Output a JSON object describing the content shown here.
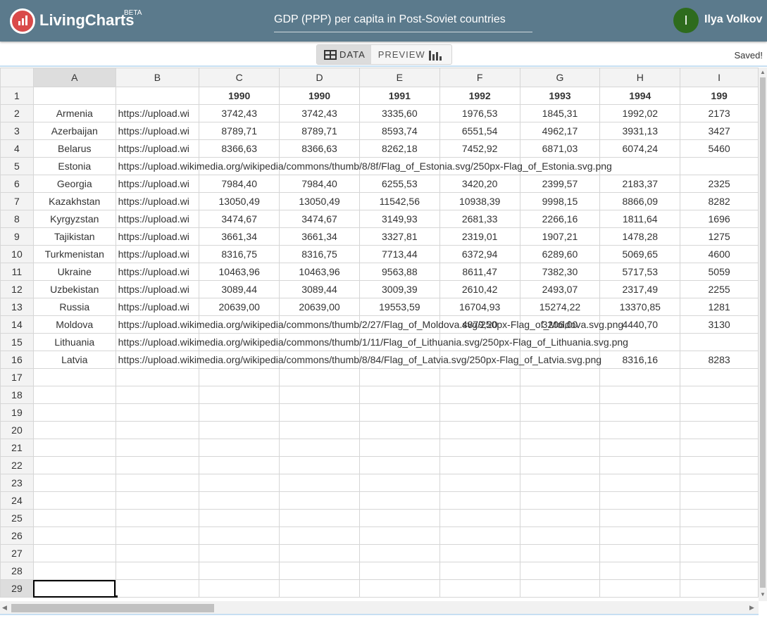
{
  "header": {
    "brand": "LivingCharts",
    "beta": "BETA",
    "chart_title": "GDP (PPP) per capita in Post-Soviet countries",
    "user_initial": "I",
    "user_name": "Ilya Volkov"
  },
  "toolbar": {
    "data_label": "DATA",
    "preview_label": "PREVIEW",
    "status": "Saved!"
  },
  "sheet": {
    "columns": [
      "A",
      "B",
      "C",
      "D",
      "E",
      "F",
      "G",
      "H",
      "I"
    ],
    "rows": [
      [
        "",
        "",
        "1990",
        "1990",
        "1991",
        "1992",
        "1993",
        "1994",
        "199"
      ],
      [
        "Armenia",
        "https://upload.wi",
        "3742,43",
        "3742,43",
        "3335,60",
        "1976,53",
        "1845,31",
        "1992,02",
        "2173"
      ],
      [
        "Azerbaijan",
        "https://upload.wi",
        "8789,71",
        "8789,71",
        "8593,74",
        "6551,54",
        "4962,17",
        "3931,13",
        "3427"
      ],
      [
        "Belarus",
        "https://upload.wi",
        "8366,63",
        "8366,63",
        "8262,18",
        "7452,92",
        "6871,03",
        "6074,24",
        "5460"
      ],
      [
        "Estonia",
        "https://upload.wikimedia.org/wikipedia/commons/thumb/8/8f/Flag_of_Estonia.svg/250px-Flag_of_Estonia.svg.png",
        "",
        "",
        "",
        "",
        "",
        "",
        ""
      ],
      [
        "Georgia",
        "https://upload.wi",
        "7984,40",
        "7984,40",
        "6255,53",
        "3420,20",
        "2399,57",
        "2183,37",
        "2325"
      ],
      [
        "Kazakhstan",
        "https://upload.wi",
        "13050,49",
        "13050,49",
        "11542,56",
        "10938,39",
        "9998,15",
        "8866,09",
        "8282"
      ],
      [
        "Kyrgyzstan",
        "https://upload.wi",
        "3474,67",
        "3474,67",
        "3149,93",
        "2681,33",
        "2266,16",
        "1811,64",
        "1696"
      ],
      [
        "Tajikistan",
        "https://upload.wi",
        "3661,34",
        "3661,34",
        "3327,81",
        "2319,01",
        "1907,21",
        "1478,28",
        "1275"
      ],
      [
        "Turkmenistan",
        "https://upload.wi",
        "8316,75",
        "8316,75",
        "7713,44",
        "6372,94",
        "6289,60",
        "5069,65",
        "4600"
      ],
      [
        "Ukraine",
        "https://upload.wi",
        "10463,96",
        "10463,96",
        "9563,88",
        "8611,47",
        "7382,30",
        "5717,53",
        "5059"
      ],
      [
        "Uzbekistan",
        "https://upload.wi",
        "3089,44",
        "3089,44",
        "3009,39",
        "2610,42",
        "2493,07",
        "2317,49",
        "2255"
      ],
      [
        "Russia",
        "https://upload.wi",
        "20639,00",
        "20639,00",
        "19553,59",
        "16704,93",
        "15274,22",
        "13370,85",
        "1281"
      ],
      [
        "Moldova",
        "https://upload.wikimedia.org/wikipedia/commons/thumb/2/27/Flag_of_Moldova.svg/250px-Flag_of_Moldova.svg.png",
        "",
        "",
        "",
        "4879,20",
        "3206,00",
        "4440,70",
        "3130"
      ],
      [
        "Lithuania",
        "https://upload.wikimedia.org/wikipedia/commons/thumb/1/11/Flag_of_Lithuania.svg/250px-Flag_of_Lithuania.svg.png",
        "",
        "",
        "",
        "",
        "",
        "",
        ""
      ],
      [
        "Latvia",
        "https://upload.wikimedia.org/wikipedia/commons/thumb/8/84/Flag_of_Latvia.svg/250px-Flag_of_Latvia.svg.png",
        "",
        "",
        "",
        "",
        "",
        "8316,16",
        "8283"
      ]
    ],
    "empty_row_numbers": [
      17,
      18,
      19,
      20,
      21,
      22,
      23,
      24,
      25,
      26,
      27,
      28,
      29
    ],
    "selected_cell": "A29"
  }
}
